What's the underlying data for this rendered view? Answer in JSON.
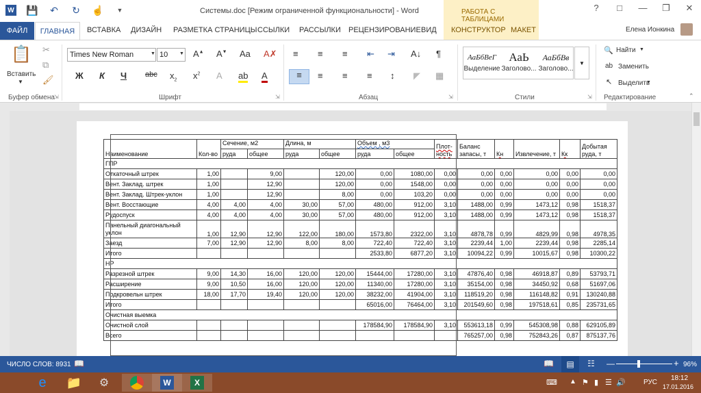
{
  "window": {
    "title": "Системы.doc [Режим ограниченной функциональности] - Word",
    "contextual_group": "РАБОТА С ТАБЛИЦАМИ",
    "user": "Елена Ионкина"
  },
  "tabs": {
    "file": "ФАЙЛ",
    "home": "ГЛАВНАЯ",
    "insert": "ВСТАВКА",
    "design": "ДИЗАЙН",
    "layout": "РАЗМЕТКА СТРАНИЦЫ",
    "references": "ССЫЛКИ",
    "mailings": "РАССЫЛКИ",
    "review": "РЕЦЕНЗИРОВАНИЕ",
    "view": "ВИД",
    "constructor": "КОНСТРУКТОР",
    "maket": "МАКЕТ"
  },
  "ribbon": {
    "paste": "Вставить",
    "font_name": "Times New Roman",
    "font_size": "10",
    "groups": {
      "clipboard": "Буфер обмена",
      "font": "Шрифт",
      "paragraph": "Абзац",
      "styles": "Стили",
      "editing": "Редактирование"
    },
    "styles": [
      {
        "preview": "АаБбВеГ",
        "label": "Выделение"
      },
      {
        "preview": "АаЬ",
        "label": "Заголово..."
      },
      {
        "preview": "АаБбВв",
        "label": "Заголово..."
      }
    ],
    "find": "Найти",
    "replace": "Заменить",
    "select": "Выделить"
  },
  "table": {
    "header1": [
      "Наименование",
      "Кол-во",
      "Сечение, м2",
      "Длина, м",
      "Объем , м3",
      "Плот-ность",
      "Баланс запасы, т",
      "Кн",
      "Извлечение, т",
      "Кк",
      "Добытая руда, т"
    ],
    "header2": [
      "руда",
      "общее",
      "руда",
      "общее",
      "руда",
      "общее"
    ],
    "rows": [
      {
        "section": "ГПР"
      },
      {
        "cells": [
          "Откаточный штрек",
          "1,00",
          "",
          "9,00",
          "",
          "120,00",
          "0,00",
          "1080,00",
          "0,00",
          "0,00",
          "0,00",
          "0,00",
          "0,00",
          "0,00"
        ]
      },
      {
        "cells": [
          "Вент. Заклад. штрек",
          "1,00",
          "",
          "12,90",
          "",
          "120,00",
          "0,00",
          "1548,00",
          "0,00",
          "0,00",
          "0,00",
          "0,00",
          "0,00",
          "0,00"
        ]
      },
      {
        "cells": [
          "Вент. Заклад. Штрек-уклон",
          "1,00",
          "",
          "12,90",
          "",
          "8,00",
          "0,00",
          "103,20",
          "0,00",
          "0,00",
          "0,00",
          "0,00",
          "0,00",
          "0,00"
        ]
      },
      {
        "cells": [
          "Вент. Восстающие",
          "4,00",
          "4,00",
          "4,00",
          "30,00",
          "57,00",
          "480,00",
          "912,00",
          "3,10",
          "1488,00",
          "0,99",
          "1473,12",
          "0,98",
          "1518,37"
        ]
      },
      {
        "cells": [
          "Рудоспуск",
          "4,00",
          "4,00",
          "4,00",
          "30,00",
          "57,00",
          "480,00",
          "912,00",
          "3,10",
          "1488,00",
          "0,99",
          "1473,12",
          "0,98",
          "1518,37"
        ]
      },
      {
        "cells": [
          "Панельный диагональный уклон",
          "1,00",
          "12,90",
          "12,90",
          "122,00",
          "180,00",
          "1573,80",
          "2322,00",
          "3,10",
          "4878,78",
          "0,99",
          "4829,99",
          "0,98",
          "4978,35"
        ],
        "tall": true
      },
      {
        "cells": [
          "Заезд",
          "7,00",
          "12,90",
          "12,90",
          "8,00",
          "8,00",
          "722,40",
          "722,40",
          "3,10",
          "2239,44",
          "1,00",
          "2239,44",
          "0,98",
          "2285,14"
        ]
      },
      {
        "cells": [
          "Итого",
          "",
          "",
          "",
          "",
          "",
          "2533,80",
          "6877,20",
          "3,10",
          "10094,22",
          "0,99",
          "10015,67",
          "0,98",
          "10300,22"
        ]
      },
      {
        "section": "НР"
      },
      {
        "cells": [
          "Разрезной штрек",
          "9,00",
          "14,30",
          "16,00",
          "120,00",
          "120,00",
          "15444,00",
          "17280,00",
          "3,10",
          "47876,40",
          "0,98",
          "46918,87",
          "0,89",
          "53793,71"
        ]
      },
      {
        "cells": [
          "Расширение",
          "9,00",
          "10,50",
          "16,00",
          "120,00",
          "120,00",
          "11340,00",
          "17280,00",
          "3,10",
          "35154,00",
          "0,98",
          "34450,92",
          "0,68",
          "51697,06"
        ]
      },
      {
        "cells": [
          "Подкровельн штрек",
          "18,00",
          "17,70",
          "19,40",
          "120,00",
          "120,00",
          "38232,00",
          "41904,00",
          "3,10",
          "118519,20",
          "0,98",
          "116148,82",
          "0,91",
          "130240,88"
        ]
      },
      {
        "cells": [
          "Итого",
          "",
          "",
          "",
          "",
          "",
          "65016,00",
          "76464,00",
          "3,10",
          "201549,60",
          "0,98",
          "197518,61",
          "0,85",
          "235731,65"
        ]
      },
      {
        "section": "Очистная выемка"
      },
      {
        "cells": [
          "Очистной слой",
          "",
          "",
          "",
          "",
          "",
          "178584,90",
          "178584,90",
          "3,10",
          "553613,18",
          "0,99",
          "545308,98",
          "0,88",
          "629105,89"
        ]
      },
      {
        "cells": [
          "Всего",
          "",
          "",
          "",
          "",
          "",
          "",
          "",
          "",
          "765257,00",
          "0,98",
          "752843,26",
          "0,87",
          "875137,76"
        ]
      }
    ]
  },
  "statusbar": {
    "word_count": "ЧИСЛО СЛОВ: 8931",
    "zoom": "96%"
  },
  "taskbar": {
    "lang": "РУС",
    "time": "18:12",
    "date": "17.01.2016"
  }
}
